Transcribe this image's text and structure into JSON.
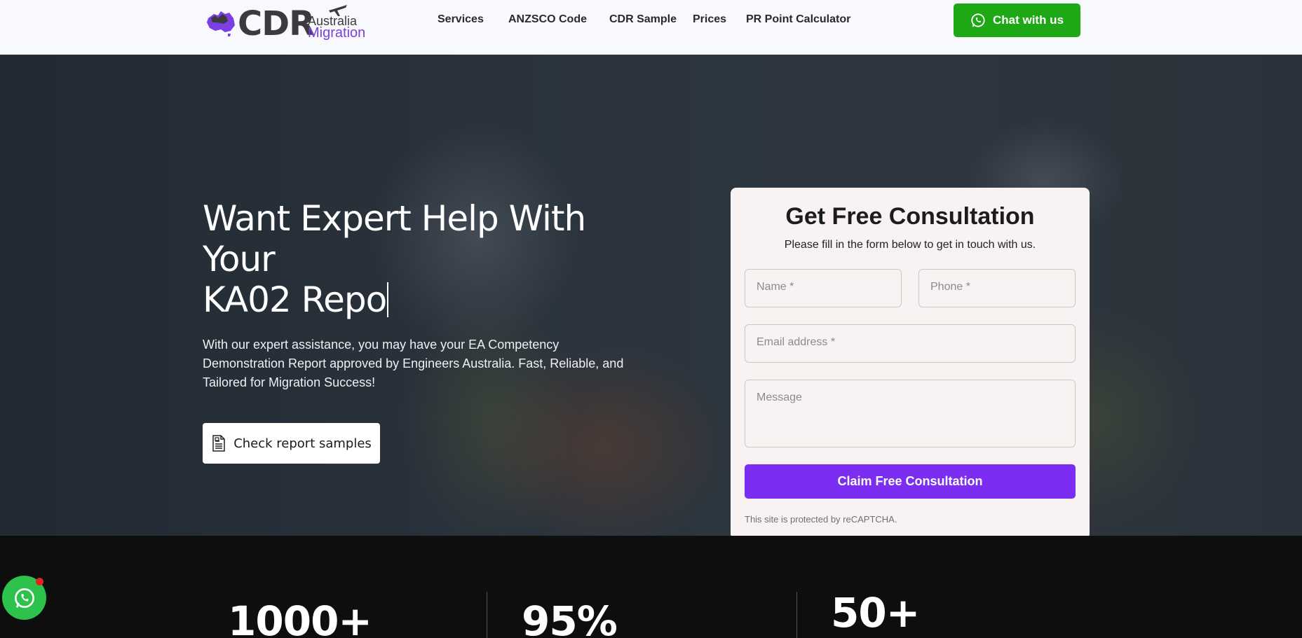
{
  "header": {
    "logo": {
      "brand": "CDR",
      "line1": "Australia",
      "line2": "Migration"
    },
    "nav": [
      {
        "id": "services",
        "label": "Services"
      },
      {
        "id": "anzsco",
        "label": "ANZSCO Code"
      },
      {
        "id": "cdr-sample",
        "label": "CDR Sample"
      },
      {
        "id": "prices",
        "label": "Prices"
      },
      {
        "id": "pr-calculator",
        "label": "PR Point Calculator"
      }
    ],
    "chat_button": {
      "label": "Chat with us",
      "icon": "whatsapp-icon",
      "color": "#1fa815"
    }
  },
  "hero": {
    "title_line1": "Want Expert Help With Your",
    "title_line2": "KA02 Repo",
    "description": "With our expert assistance, you may have your EA Competency Demonstration Report approved by Engineers Australia. Fast, Reliable, and Tailored for Migration Success!",
    "samples_button": {
      "label": "Check report samples",
      "icon": "document-icon"
    }
  },
  "form": {
    "title": "Get Free Consultation",
    "subtitle": "Please fill in the form below to get in touch with us.",
    "name_placeholder": "Name *",
    "phone_placeholder": "Phone *",
    "email_placeholder": "Email address *",
    "message_placeholder": "Message",
    "submit_label": "Claim Free Consultation",
    "recaptcha_note": "This site is protected by reCAPTCHA.",
    "accent": "#7c2df2"
  },
  "stats": [
    {
      "value": "1000+"
    },
    {
      "value": "95%"
    },
    {
      "value": "50+"
    }
  ],
  "floating_chat": {
    "icon": "whatsapp-icon",
    "color": "#2dc24c"
  }
}
